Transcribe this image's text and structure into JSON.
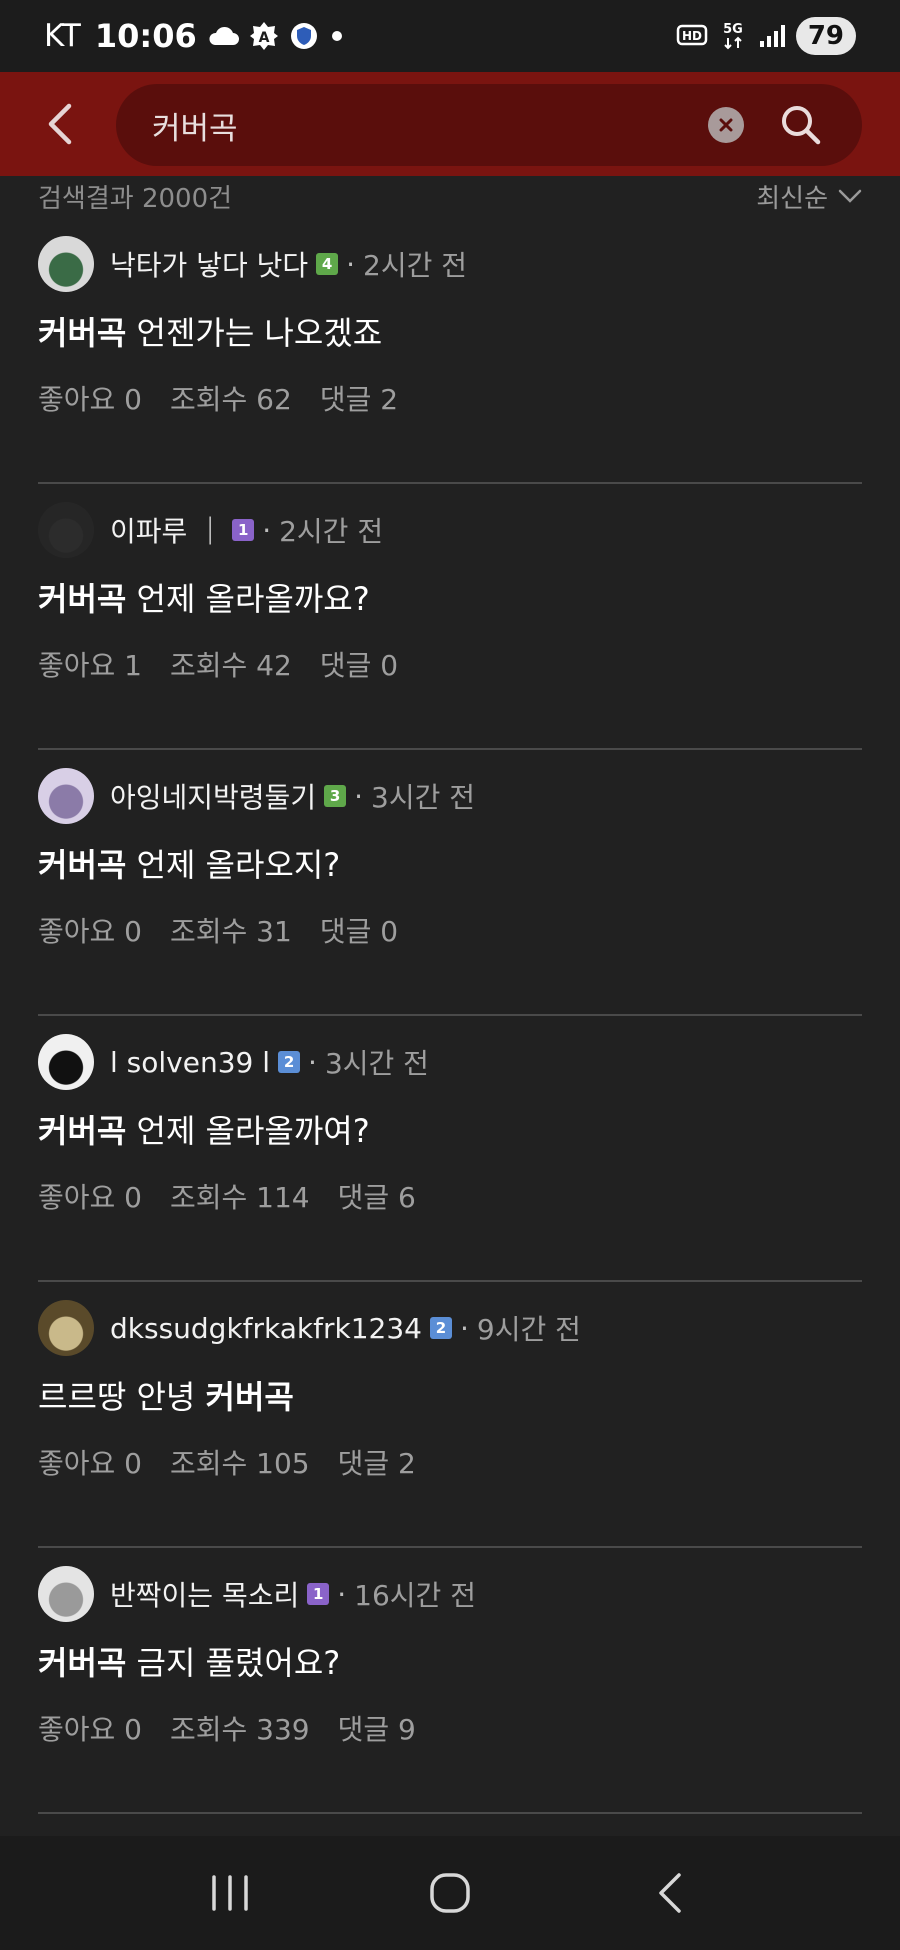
{
  "status_bar": {
    "carrier": "KT",
    "time": "10:06",
    "battery": "79",
    "icons": [
      "cloud-icon",
      "gear-a-icon",
      "shield-icon",
      "dot-icon",
      "hd-icon",
      "5g-icon",
      "signal-icon"
    ]
  },
  "search": {
    "query": "커버곡",
    "icons": {
      "back": "chevron-left-icon",
      "clear": "clear-icon",
      "search": "search-icon"
    }
  },
  "summary": {
    "count_text": "검색결과 2000건",
    "sort_label": "최신순"
  },
  "posts": [
    {
      "author": "낙타가 낳다 낫다",
      "level": "4",
      "level_color": "#5fa84a",
      "time": "2시간 전",
      "title_pre": "",
      "keyword": "커버곡",
      "title_post": " 언젠가는 나오겠죠",
      "likes": "좋아요 0",
      "views": "조회수 62",
      "comments": "댓글 2",
      "avatar_colors": [
        "#d9d9d9",
        "#3a6b46"
      ]
    },
    {
      "author": "이파루 ｜",
      "level": "1",
      "level_color": "#8a63c9",
      "time": "2시간 전",
      "title_pre": "",
      "keyword": "커버곡",
      "title_post": " 언제 올라올까요?",
      "likes": "좋아요 1",
      "views": "조회수 42",
      "comments": "댓글 0",
      "avatar_colors": [
        "#262626",
        "#2c2c2c"
      ]
    },
    {
      "author": "아잉네지박령둘기",
      "level": "3",
      "level_color": "#5fa84a",
      "time": "3시간 전",
      "title_pre": "",
      "keyword": "커버곡",
      "title_post": " 언제 올라오지?",
      "likes": "좋아요 0",
      "views": "조회수 31",
      "comments": "댓글 0",
      "avatar_colors": [
        "#d8cfe6",
        "#8b7ba8"
      ]
    },
    {
      "author": "l solven39 l",
      "level": "2",
      "level_color": "#5b8ed6",
      "time": "3시간 전",
      "title_pre": "",
      "keyword": "커버곡",
      "title_post": " 언제 올라올까여?",
      "likes": "좋아요 0",
      "views": "조회수 114",
      "comments": "댓글 6",
      "avatar_colors": [
        "#f0f0f0",
        "#111111"
      ]
    },
    {
      "author": "dkssudgkfrkakfrk1234",
      "level": "2",
      "level_color": "#5b8ed6",
      "time": "9시간 전",
      "title_pre": "르르땅 안녕 ",
      "keyword": "커버곡",
      "title_post": "",
      "likes": "좋아요 0",
      "views": "조회수 105",
      "comments": "댓글 2",
      "avatar_colors": [
        "#5a4a2a",
        "#c9b98a"
      ]
    },
    {
      "author": "반짝이는 목소리",
      "level": "1",
      "level_color": "#8a63c9",
      "time": "16시간 전",
      "title_pre": "",
      "keyword": "커버곡",
      "title_post": " 금지 풀렸어요?",
      "likes": "좋아요 0",
      "views": "조회수 339",
      "comments": "댓글 9",
      "avatar_colors": [
        "#e4e4e4",
        "#9a9a9a"
      ]
    }
  ],
  "nav": {
    "icons": [
      "recent-apps-icon",
      "home-icon",
      "back-icon"
    ]
  }
}
